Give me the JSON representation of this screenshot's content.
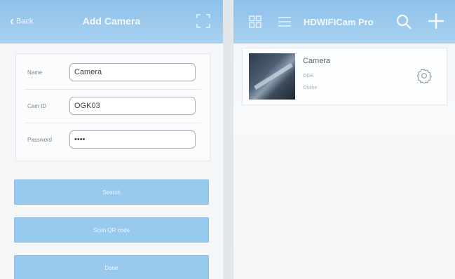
{
  "add_camera": {
    "back_label": "Back",
    "title": "Add Camera",
    "form": {
      "name_label": "Name",
      "name_value": "Camera",
      "camid_label": "Cam ID",
      "camid_value": "OGK03",
      "password_label": "Password",
      "password_value": "••••"
    },
    "buttons": {
      "search": "Search",
      "scan_qr": "Scan QR code",
      "done": "Done"
    }
  },
  "camera_list": {
    "title": "HDWIFICam Pro",
    "cameras": [
      {
        "name": "Camera",
        "id": "OGK",
        "status": "Online"
      }
    ]
  },
  "colors": {
    "navbar": "#9ccbf0",
    "button": "#98c9ef",
    "background": "#f4f6f8"
  }
}
